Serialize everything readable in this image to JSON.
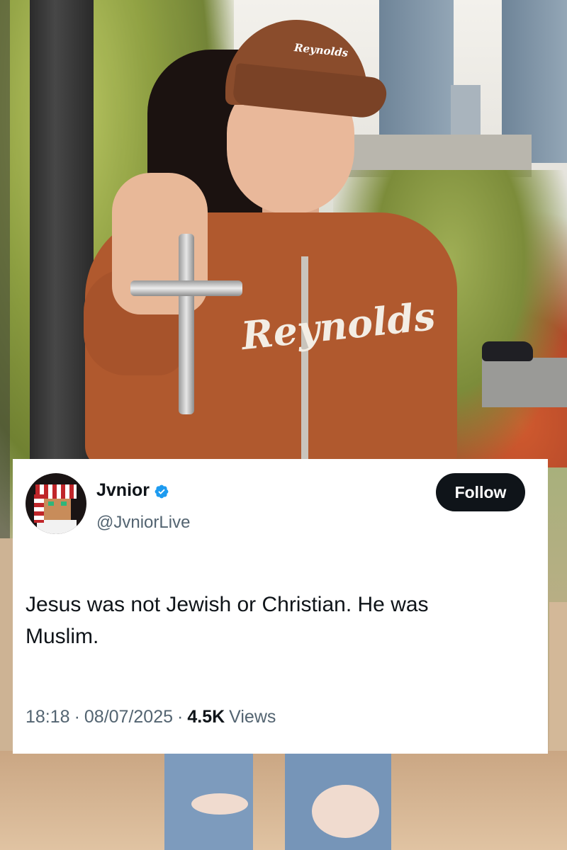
{
  "photo": {
    "cap_logo": "Reynolds",
    "jacket_text": "Reynolds"
  },
  "tweet": {
    "display_name": "Jvnior",
    "handle": "@JvniorLive",
    "follow_label": "Follow",
    "text": "Jesus was not Jewish or Christian. He was Muslim.",
    "time": "18:18",
    "separator": "·",
    "date": "08/07/2025",
    "views_count": "4.5K",
    "views_label": "Views"
  },
  "colors": {
    "verified_badge": "#1d9bf0",
    "follow_button": "#0f1419",
    "secondary_text": "#536471"
  },
  "icons": {
    "verified": "verified-badge-icon"
  }
}
